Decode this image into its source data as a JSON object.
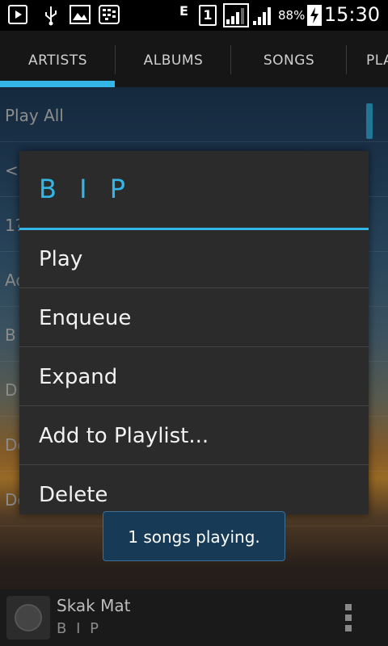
{
  "status_bar": {
    "battery_percent": "88%",
    "time": "15:30",
    "network_type": "E",
    "sim_slot": "1",
    "icons": [
      "play-notification-icon",
      "usb-icon",
      "image-icon",
      "bbm-icon",
      "network-e-icon",
      "sim-1-icon",
      "signal-1-icon",
      "signal-2-icon",
      "battery-charging-icon"
    ]
  },
  "tabs": [
    {
      "label": "ARTISTS",
      "selected": true
    },
    {
      "label": "ALBUMS",
      "selected": false
    },
    {
      "label": "SONGS",
      "selected": false
    },
    {
      "label": "PLA",
      "selected": false
    }
  ],
  "list_behind": [
    "Play All",
    "<u",
    "1?",
    "Ac",
    "B",
    "D",
    "De",
    "De"
  ],
  "dialog": {
    "title": "B I P",
    "items": [
      "Play",
      "Enqueue",
      "Expand",
      "Add to Playlist...",
      "Delete"
    ]
  },
  "toast": {
    "text": "1 songs playing."
  },
  "now_playing": {
    "song": "Skak Mat",
    "artist": "B I P",
    "overflow_icon": "overflow-menu-icon"
  },
  "colors": {
    "accent": "#33b5e5",
    "dialog_bg": "#2b2b2b",
    "toast_bg": "#173b57"
  }
}
